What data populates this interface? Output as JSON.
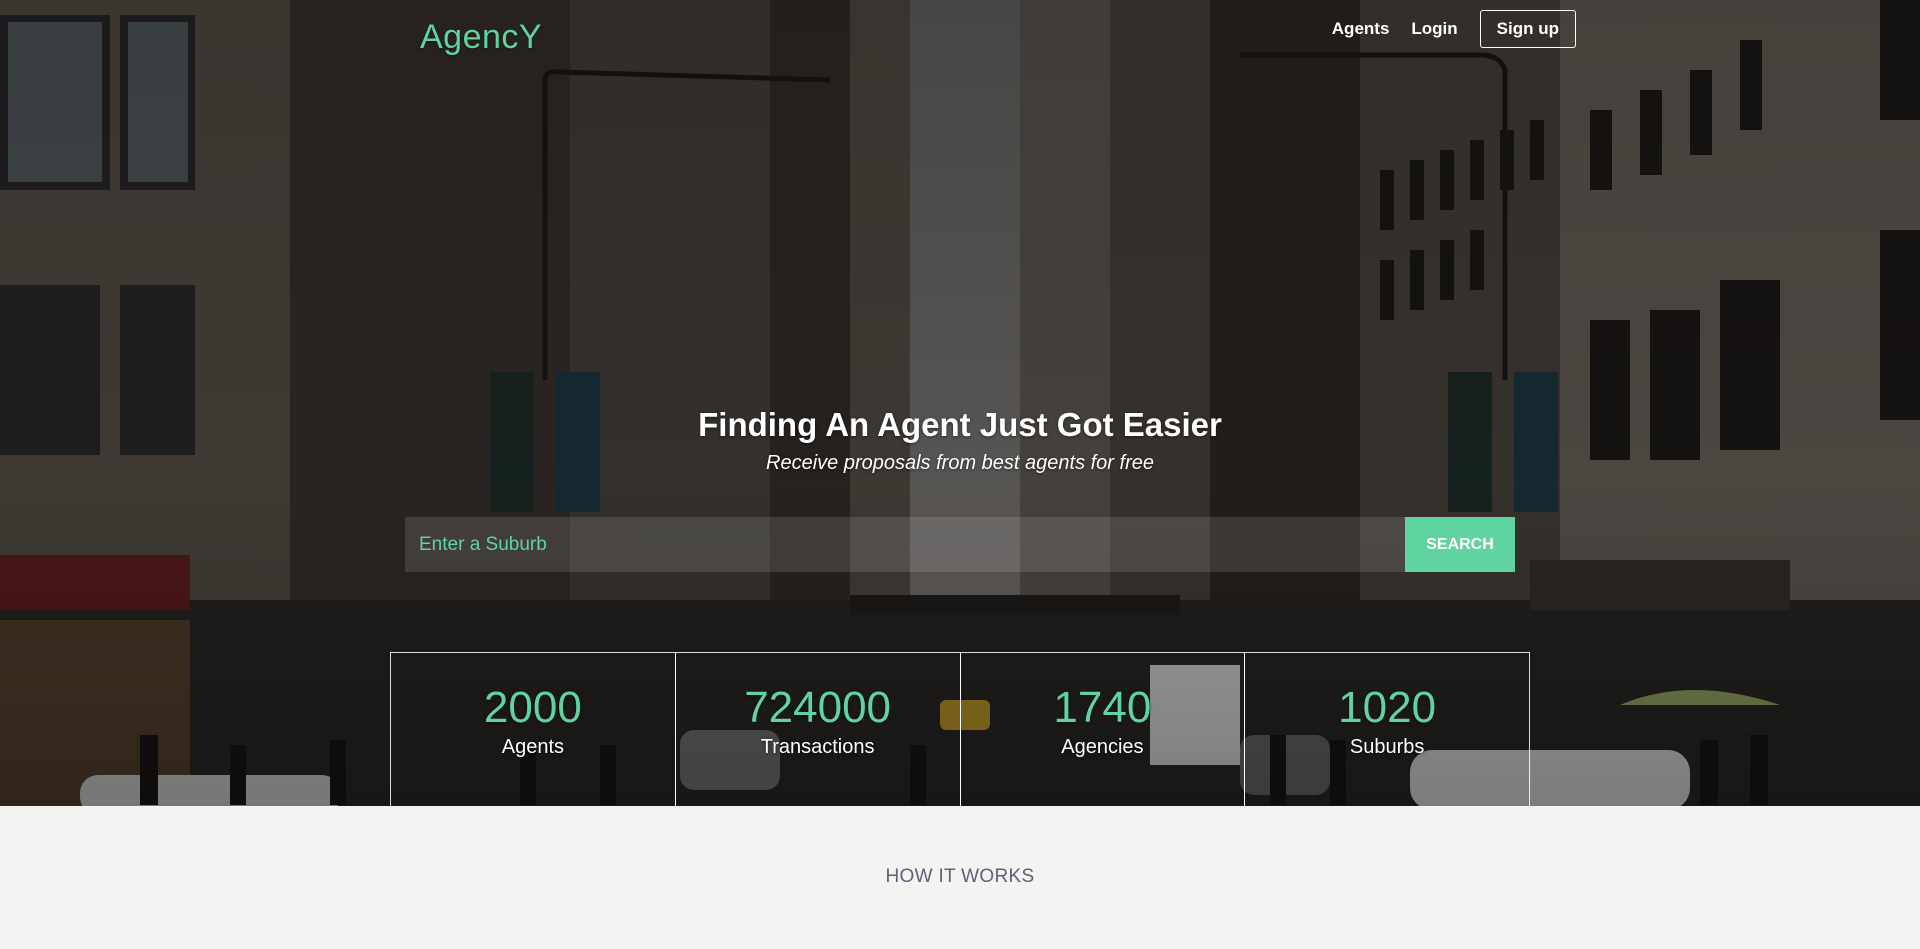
{
  "brand": {
    "logo": "AgencY",
    "accent_color": "#5fd3a0"
  },
  "nav": {
    "agents": "Agents",
    "login": "Login",
    "signup": "Sign up"
  },
  "hero": {
    "headline": "Finding An Agent Just Got Easier",
    "subheadline": "Receive proposals from best agents for free",
    "background": "city-street-photo"
  },
  "search": {
    "placeholder": "Enter a Suburb",
    "value": "",
    "button_label": "SEARCH"
  },
  "stats": [
    {
      "value": "2000",
      "label": "Agents"
    },
    {
      "value": "724000",
      "label": "Transactions"
    },
    {
      "value": "1740",
      "label": "Agencies"
    },
    {
      "value": "1020",
      "label": "Suburbs"
    }
  ],
  "section": {
    "how_it_works": "HOW IT WORKS"
  }
}
